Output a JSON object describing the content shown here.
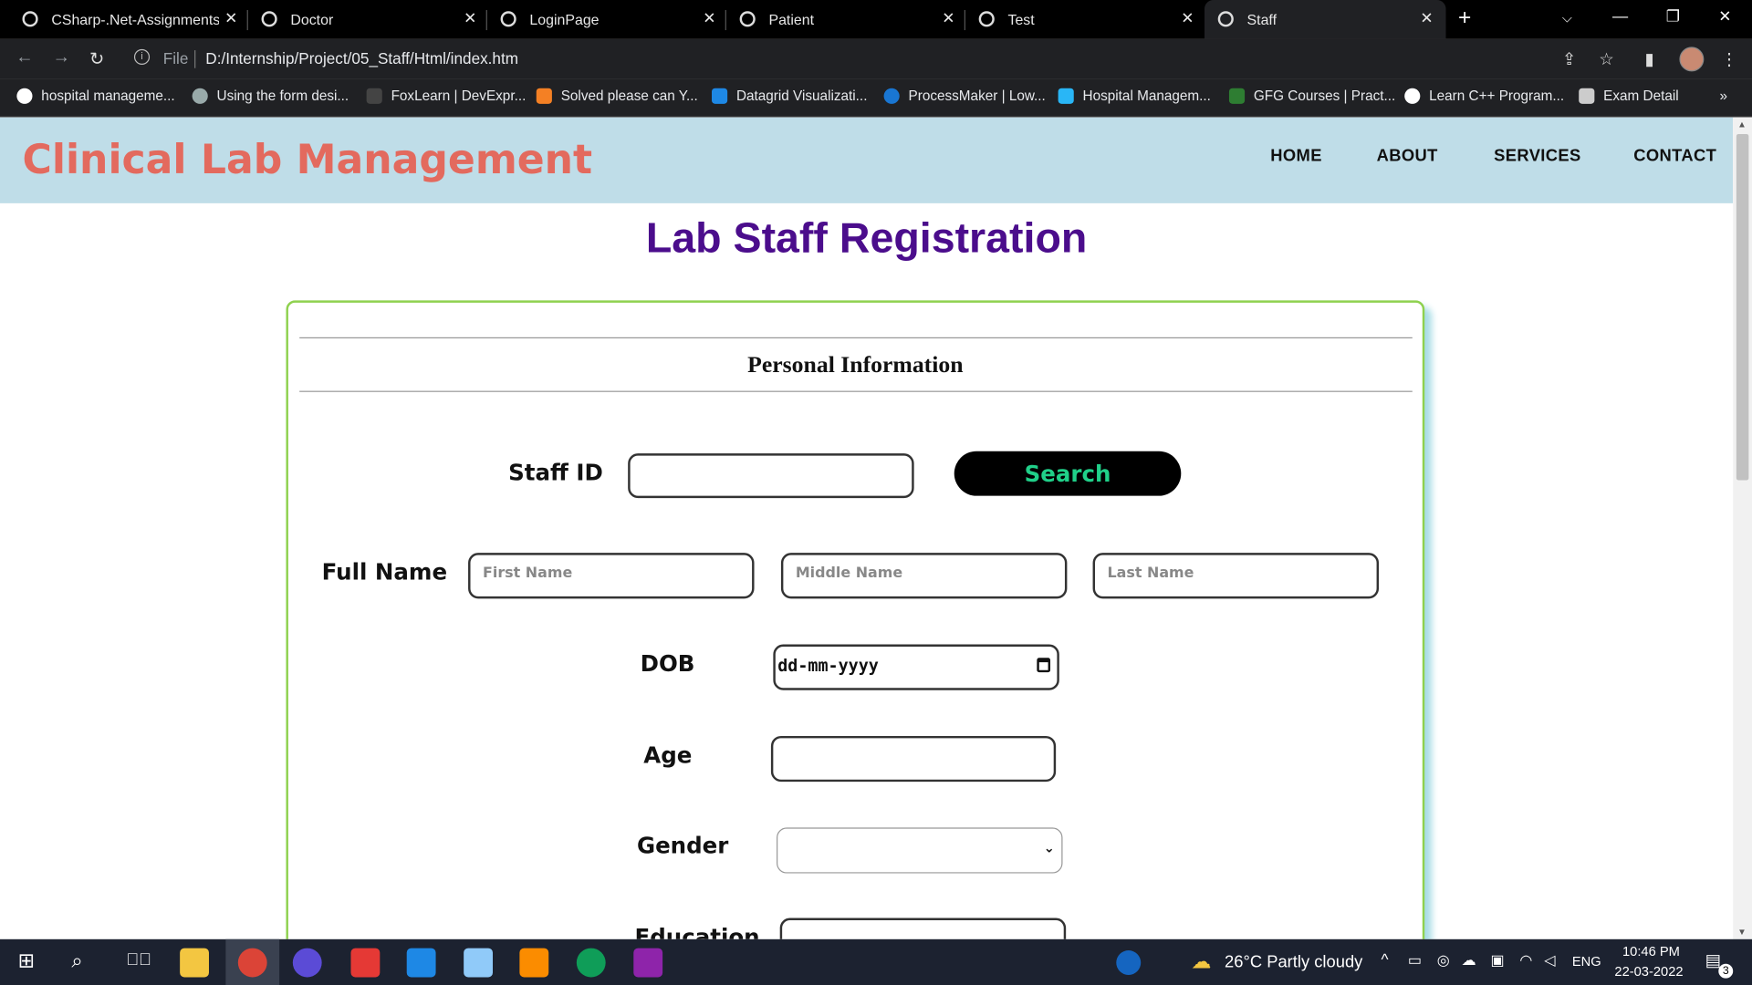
{
  "browser": {
    "tabs": [
      {
        "title": "CSharp-.Net-Assignments/",
        "active": false
      },
      {
        "title": "Doctor",
        "active": false
      },
      {
        "title": "LoginPage",
        "active": false
      },
      {
        "title": "Patient",
        "active": false
      },
      {
        "title": "Test",
        "active": false
      },
      {
        "title": "Staff",
        "active": true
      }
    ],
    "address": {
      "scheme_label": "File",
      "url": "D:/Internship/Project/05_Staff/Html/index.htm"
    },
    "bookmarks": [
      "hospital manageme...",
      "Using the form desi...",
      "FoxLearn | DevExpr...",
      "Solved please can Y...",
      "Datagrid Visualizati...",
      "ProcessMaker | Low...",
      "Hospital Managem...",
      "GFG Courses | Pract...",
      "Learn C++ Program...",
      "Exam Detail"
    ],
    "bookmarks_more": "»"
  },
  "site": {
    "brand": "Clinical Lab Management",
    "nav": [
      "HOME",
      "ABOUT",
      "SERVICES",
      "CONTACT"
    ],
    "page_title": "Lab Staff Registration",
    "section_title": "Personal Information",
    "form": {
      "staff_id_label": "Staff ID",
      "search_label": "Search",
      "full_name_label": "Full Name",
      "first_name_placeholder": "First Name",
      "middle_name_placeholder": "Middle Name",
      "last_name_placeholder": "Last Name",
      "dob_label": "DOB",
      "dob_value": "dd-mm-yyyy",
      "age_label": "Age",
      "gender_label": "Gender",
      "education_label": "Education"
    }
  },
  "taskbar": {
    "weather": "26°C  Partly cloudy",
    "language": "ENG",
    "time": "10:46 PM",
    "date": "22-03-2022",
    "notifications": "3"
  }
}
